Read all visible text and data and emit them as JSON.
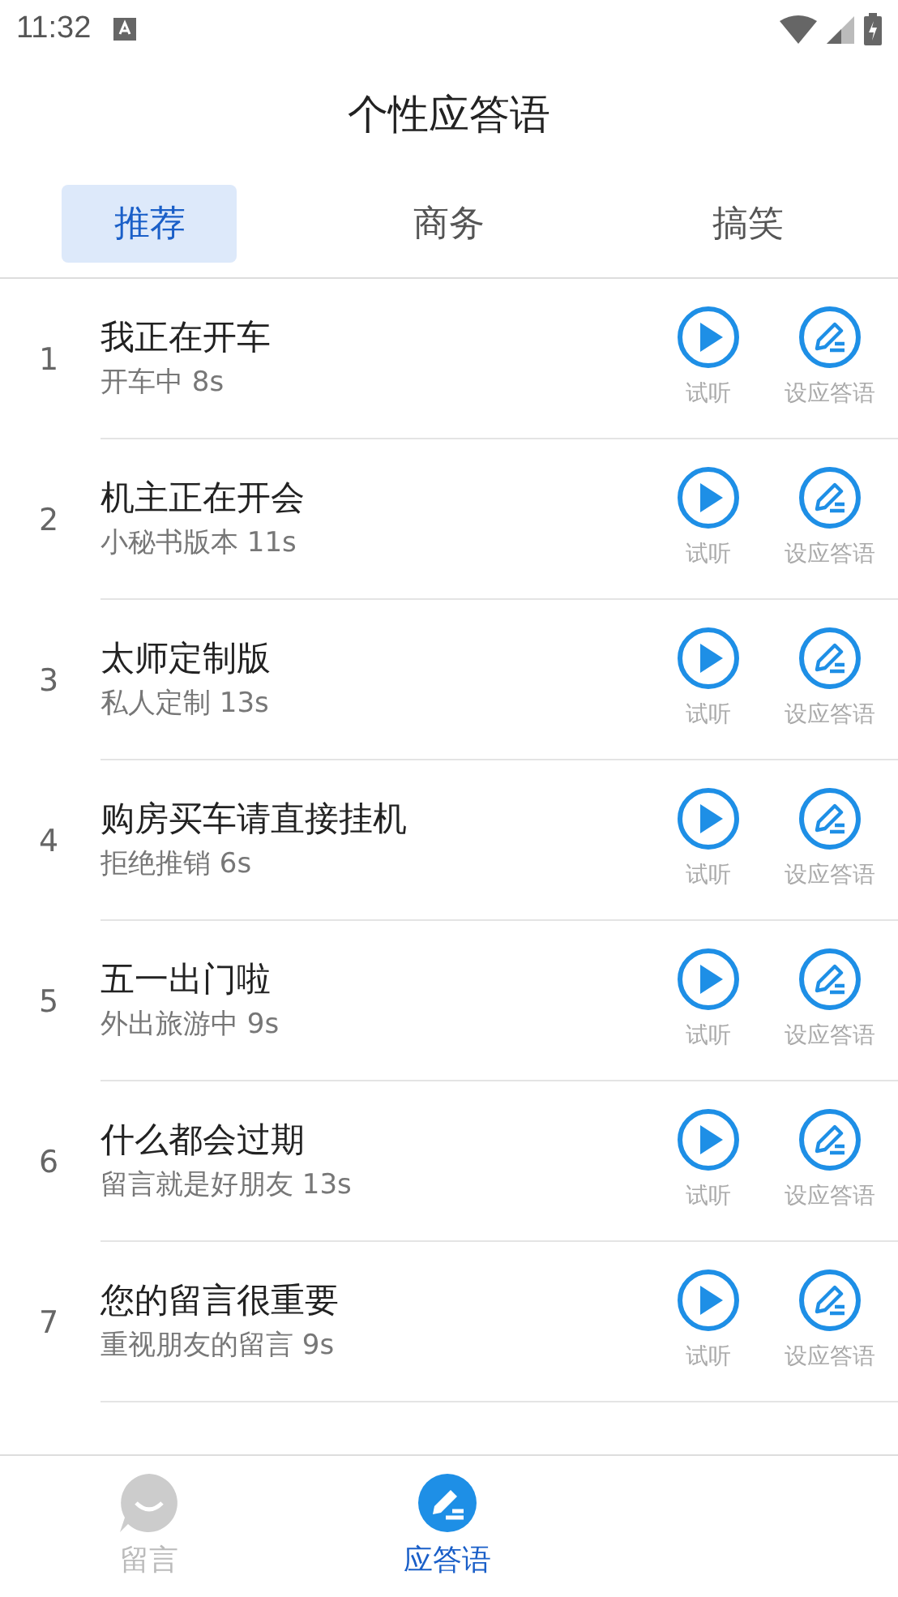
{
  "status_bar": {
    "time": "11:32"
  },
  "header": {
    "title": "个性应答语"
  },
  "tabs": [
    {
      "label": "推荐",
      "selected": true
    },
    {
      "label": "商务",
      "selected": false
    },
    {
      "label": "搞笑",
      "selected": false
    }
  ],
  "greetings": [
    {
      "number": "1",
      "title": "我正在开车",
      "subtitle": "开车中 8s",
      "listen_label": "试听",
      "set_label": "设应答语"
    },
    {
      "number": "2",
      "title": "机主正在开会",
      "subtitle": "小秘书版本 11s",
      "listen_label": "试听",
      "set_label": "设应答语"
    },
    {
      "number": "3",
      "title": "太师定制版",
      "subtitle": "私人定制 13s",
      "listen_label": "试听",
      "set_label": "设应答语"
    },
    {
      "number": "4",
      "title": "购房买车请直接挂机",
      "subtitle": "拒绝推销 6s",
      "listen_label": "试听",
      "set_label": "设应答语"
    },
    {
      "number": "5",
      "title": "五一出门啦",
      "subtitle": "外出旅游中 9s",
      "listen_label": "试听",
      "set_label": "设应答语"
    },
    {
      "number": "6",
      "title": "什么都会过期",
      "subtitle": "留言就是好朋友 13s",
      "listen_label": "试听",
      "set_label": "设应答语"
    },
    {
      "number": "7",
      "title": "您的留言很重要",
      "subtitle": "重视朋友的留言 9s",
      "listen_label": "试听",
      "set_label": "设应答语"
    }
  ],
  "bottom_nav": [
    {
      "label": "留言",
      "kind": "message",
      "selected": false
    },
    {
      "label": "应答语",
      "kind": "reply",
      "selected": true
    }
  ]
}
